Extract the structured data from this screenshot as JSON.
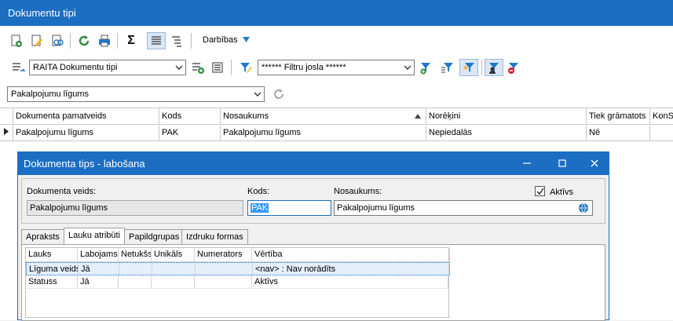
{
  "window": {
    "title": "Dokumentu tipi"
  },
  "toolbar": {
    "darbibas_label": "Darbības"
  },
  "view_combo": {
    "value": "RAITA Dokumentu tipi"
  },
  "filter_combo": {
    "value": "****** Filtru josla ******"
  },
  "type_combo": {
    "value": "Pakalpojumu līgums"
  },
  "grid": {
    "columns": [
      "Dokumenta pamatveids",
      "Kods",
      "Nosaukums",
      "Norēķini",
      "Tiek grāmatots",
      "KonS"
    ],
    "rows": [
      [
        "Pakalpojumu līgums",
        "PAK",
        "Pakalpojumu līgums",
        "Nepiedalās",
        "Nē",
        ""
      ]
    ]
  },
  "dialog": {
    "title": "Dokumenta tips - labošana",
    "label_veids": "Dokumenta veids:",
    "label_kods": "Kods:",
    "label_nosaukums": "Nosaukums:",
    "label_aktivs": "Aktīvs",
    "veids_value": "Pakalpojumu līgums",
    "kods_value": "PAK",
    "nosaukums_value": "Pakalpojumu līgums",
    "aktivs_checked": true,
    "tabs": [
      "Apraksts",
      "Lauku atribūti",
      "Papildgrupas",
      "Izdruku formas"
    ],
    "attr_columns": [
      "Lauks",
      "Labojams",
      "Netukšs",
      "Unikāls",
      "Numerators",
      "Vērtība"
    ],
    "attr_rows": [
      [
        "Līguma veids",
        "Jā",
        "",
        "",
        "",
        "<nav> : Nav norādīts"
      ],
      [
        "Statuss",
        "Jā",
        "",
        "",
        "",
        "Aktīvs"
      ]
    ]
  },
  "colors": {
    "accent": "#1b6ec2",
    "icon_green": "#2e8b3e",
    "icon_blue": "#1f7acb",
    "icon_red": "#d0232b",
    "icon_yellow": "#f2b21f"
  }
}
